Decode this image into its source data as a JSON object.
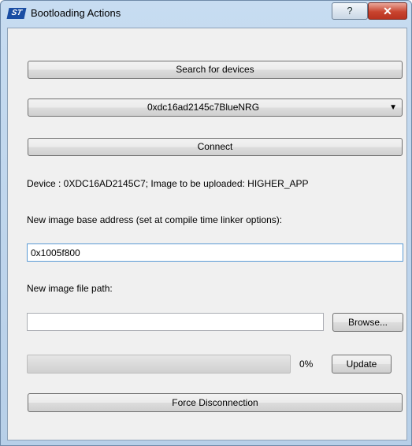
{
  "window": {
    "title": "Bootloading Actions",
    "app_icon_text": "ST",
    "help_label": "?",
    "close_label": "✕"
  },
  "buttons": {
    "search": "Search for devices",
    "connect": "Connect",
    "browse": "Browse...",
    "update": "Update",
    "force_disconnect": "Force Disconnection"
  },
  "device_select": {
    "selected": "0xdc16ad2145c7BlueNRG"
  },
  "device_info": "Device : 0XDC16AD2145C7; Image to be uploaded: HIGHER_APP",
  "base_address": {
    "label": "New image base address (set at compile time linker options):",
    "value": "0x1005f800"
  },
  "file_path": {
    "label": "New image file path:",
    "value": ""
  },
  "progress": {
    "fraction": 0,
    "text": "0%"
  },
  "colors": {
    "progress_fill": "#06b025",
    "close_button": "#c9442f"
  }
}
